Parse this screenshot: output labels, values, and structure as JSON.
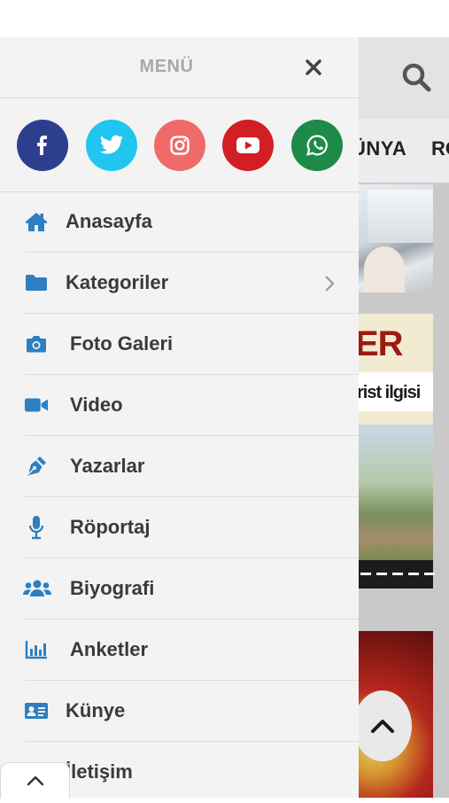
{
  "drawer": {
    "title": "MENÜ",
    "close_icon": "close-icon",
    "social": [
      {
        "name": "facebook-icon",
        "glyph": "f",
        "color": "#2e3e8f"
      },
      {
        "name": "twitter-icon",
        "glyph": "twitter",
        "color": "#20c6ef"
      },
      {
        "name": "instagram-icon",
        "glyph": "instagram",
        "color": "#f06a6a"
      },
      {
        "name": "youtube-icon",
        "glyph": "youtube",
        "color": "#d21f23"
      },
      {
        "name": "whatsapp-icon",
        "glyph": "whatsapp",
        "color": "#1d8a4a"
      }
    ],
    "menu_items": [
      {
        "label": "Anasayfa",
        "icon": "home-icon"
      },
      {
        "label": "Kategoriler",
        "icon": "folder-icon",
        "has_submenu": true
      },
      {
        "label": "Foto Galeri",
        "icon": "camera-icon"
      },
      {
        "label": "Video",
        "icon": "video-camera-icon"
      },
      {
        "label": "Yazarlar",
        "icon": "pen-icon"
      },
      {
        "label": "Röportaj",
        "icon": "microphone-icon"
      },
      {
        "label": "Biyografi",
        "icon": "users-icon"
      },
      {
        "label": "Anketler",
        "icon": "bar-chart-icon"
      },
      {
        "label": "Künye",
        "icon": "id-card-icon"
      },
      {
        "label": "İletişim",
        "icon": "envelope-icon"
      }
    ],
    "icon_color": "#2d7fc1"
  },
  "site": {
    "nav_text_1": "ÜNYA",
    "nav_text_2": "RO",
    "banner_title": "ER",
    "banner_subtitle": "rist ilgisi",
    "search_icon": "search-icon"
  }
}
